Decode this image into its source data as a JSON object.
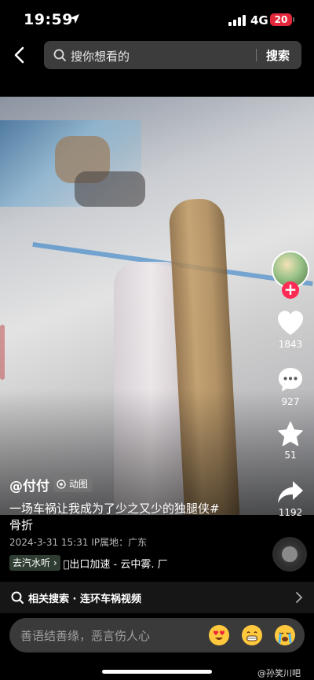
{
  "status_bar": {
    "time": "19:59",
    "network": "4G",
    "battery": "20"
  },
  "search": {
    "placeholder": "搜你想看的",
    "button": "搜索"
  },
  "actions": {
    "likes": "1843",
    "comments": "927",
    "favorites": "51",
    "shares": "1192"
  },
  "post": {
    "author": "@付付",
    "tag": "动图",
    "caption_line1": "一场车祸让我成为了少之又少的独腿侠#",
    "caption_line2": "骨折",
    "meta": "2024-3-31 15:31  IP属地：广东",
    "music_badge": "去汽水听 ›",
    "music_title": "\u0000出口加速 - 云中雾.   厂"
  },
  "related": {
    "text": "相关搜索 · 连环车祸视频"
  },
  "comment": {
    "placeholder": "善语结善缘，恶言伤人心"
  },
  "watermark": "@孙笑川吧",
  "colors": {
    "accent": "#fe2c55",
    "battery": "#e5273b"
  }
}
